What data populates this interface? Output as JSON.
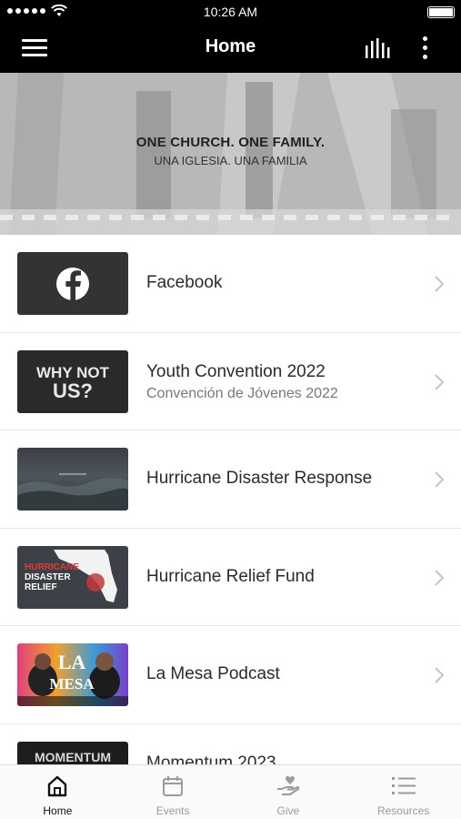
{
  "status_bar": {
    "time": "10:26 AM"
  },
  "navbar": {
    "title": "Home"
  },
  "hero": {
    "line1": "ONE CHURCH. ONE FAMILY.",
    "line2": "UNA IGLESIA. UNA FAMILIA"
  },
  "items": [
    {
      "title": "Facebook",
      "subtitle": ""
    },
    {
      "title": "Youth Convention 2022",
      "subtitle": "Convención de Jóvenes 2022",
      "thumb_text": "WHY NOT US?"
    },
    {
      "title": "Hurricane Disaster Response",
      "subtitle": ""
    },
    {
      "title": "Hurricane Relief Fund",
      "subtitle": "",
      "thumb_text": "HURRICANE DISASTER RELIEF"
    },
    {
      "title": "La Mesa Podcast",
      "subtitle": "",
      "thumb_text": "LA MESA"
    },
    {
      "title": "Momentum 2023",
      "subtitle": "",
      "thumb_text": "MOMENTUM"
    }
  ],
  "tabs": [
    {
      "label": "Home",
      "icon": "home-icon",
      "active": true
    },
    {
      "label": "Events",
      "icon": "calendar-icon"
    },
    {
      "label": "Give",
      "icon": "give-hand-heart-icon"
    },
    {
      "label": "Resources",
      "icon": "list-icon"
    }
  ]
}
